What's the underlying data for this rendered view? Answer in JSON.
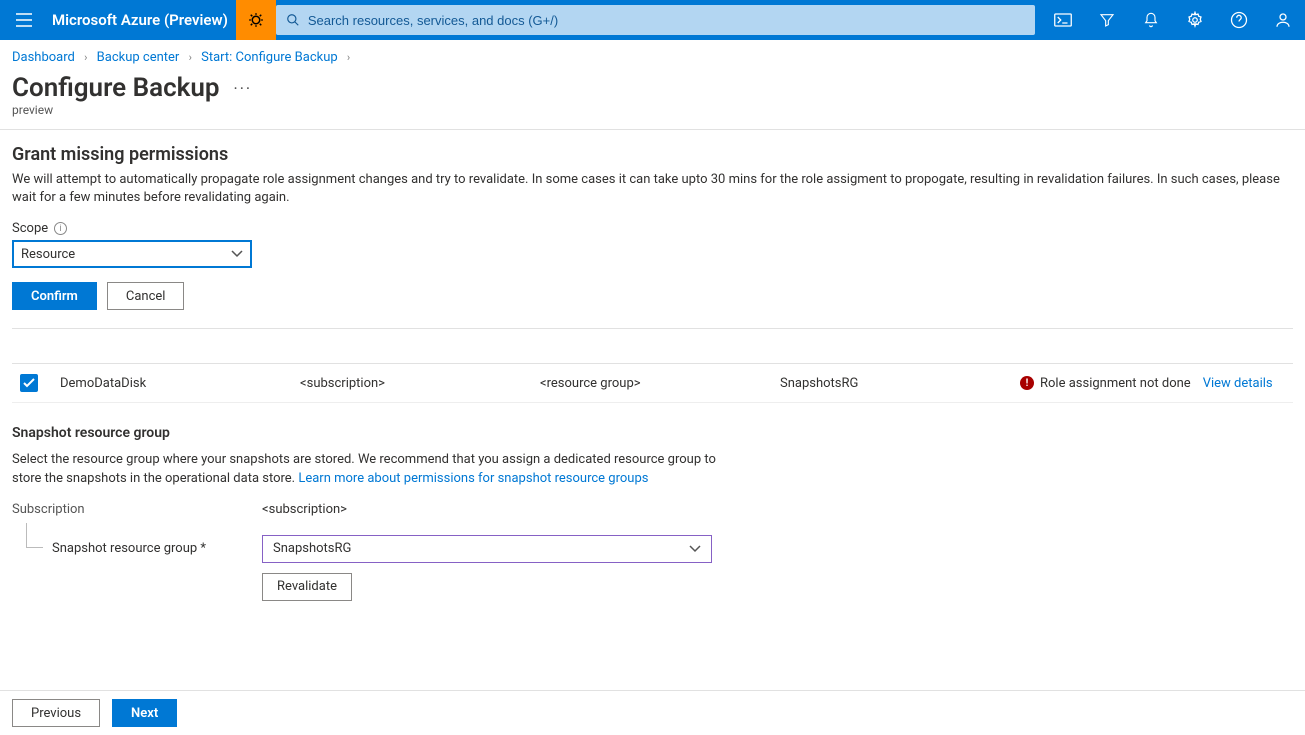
{
  "header": {
    "brand": "Microsoft Azure (Preview)",
    "search_placeholder": "Search resources, services, and docs (G+/)"
  },
  "breadcrumb": {
    "items": [
      "Dashboard",
      "Backup center",
      "Start: Configure Backup"
    ]
  },
  "page": {
    "title": "Configure Backup",
    "subtitle": "preview"
  },
  "permissions": {
    "heading": "Grant missing permissions",
    "body": "We will attempt to automatically propagate role assignment changes and try to revalidate. In some cases it can take upto 30 mins for the role assigment to propogate, resulting in revalidation failures. In such cases, please wait for a few minutes before revalidating again.",
    "scope_label": "Scope",
    "scope_value": "Resource",
    "confirm": "Confirm",
    "cancel": "Cancel"
  },
  "table": {
    "row": {
      "name": "DemoDataDisk",
      "subscription": "<subscription>",
      "resource_group": "<resource group>",
      "snapshot_rg": "SnapshotsRG",
      "status": "Role assignment not done",
      "details_link": "View details"
    }
  },
  "snapshot": {
    "heading": "Snapshot resource group",
    "desc_pre": "Select the resource group where your snapshots are stored. We recommend that you assign a dedicated resource group to store the snapshots in the operational data store. ",
    "learn_link": "Learn more about permissions for snapshot resource groups",
    "subscription_label": "Subscription",
    "subscription_value": "<subscription>",
    "rg_label": "Snapshot resource group *",
    "rg_value": "SnapshotsRG",
    "revalidate": "Revalidate"
  },
  "footer": {
    "previous": "Previous",
    "next": "Next"
  }
}
